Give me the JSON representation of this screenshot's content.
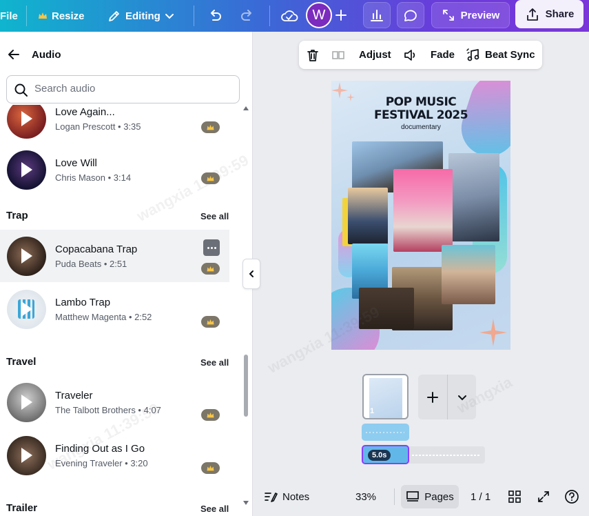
{
  "topbar": {
    "file": "File",
    "resize": "Resize",
    "editing": "Editing",
    "avatar_initial": "W",
    "preview": "Preview",
    "share": "Share"
  },
  "panel": {
    "title": "Audio",
    "search_placeholder": "Search audio",
    "sections": [
      {
        "title": "",
        "tracks": [
          {
            "title": "Love Again...",
            "meta": "Logan Prescott • 3:35"
          },
          {
            "title": "Love Will",
            "meta": "Chris Mason • 3:14"
          }
        ]
      },
      {
        "title": "Trap",
        "see_all": "See all",
        "tracks": [
          {
            "title": "Copacabana Trap",
            "meta": "Puda Beats • 2:51"
          },
          {
            "title": "Lambo Trap",
            "meta": "Matthew Magenta • 2:52"
          }
        ]
      },
      {
        "title": "Travel",
        "see_all": "See all",
        "tracks": [
          {
            "title": "Traveler",
            "meta": "The Talbott Brothers • 4:07"
          },
          {
            "title": "Finding Out as I Go",
            "meta": "Evening Traveler • 3:20"
          }
        ]
      },
      {
        "title": "Trailer",
        "see_all": "See all",
        "tracks": []
      }
    ]
  },
  "context_toolbar": {
    "adjust": "Adjust",
    "fade": "Fade",
    "beat_sync": "Beat Sync"
  },
  "design": {
    "title_line1": "POP MUSIC",
    "title_line2": "FESTIVAL 2025",
    "subtitle": "documentary"
  },
  "pages": {
    "page_number": "1",
    "duration": "5.0s"
  },
  "bottombar": {
    "notes": "Notes",
    "zoom": "33%",
    "pages": "Pages",
    "page_count": "1 / 1"
  },
  "watermark": {
    "text": "wangxia",
    "time": "11:39:59"
  },
  "colors": {
    "accent": "#8b3dff",
    "topbar_start": "#0fb5ce",
    "topbar_end": "#7a36d9",
    "crown_badge": "#7c7668"
  },
  "icons": [
    "crown-icon",
    "pencil-icon",
    "chevron-down-icon",
    "undo-icon",
    "redo-icon",
    "cloud-check-icon",
    "plus-icon",
    "chart-icon",
    "comment-icon",
    "expand-icon",
    "share-icon",
    "back-arrow-icon",
    "search-icon",
    "play-icon",
    "more-icon",
    "trash-icon",
    "flip-icon",
    "speaker-icon",
    "beat-sync-icon",
    "notes-icon",
    "pages-icon",
    "grid-icon",
    "fullscreen-icon",
    "help-icon"
  ]
}
